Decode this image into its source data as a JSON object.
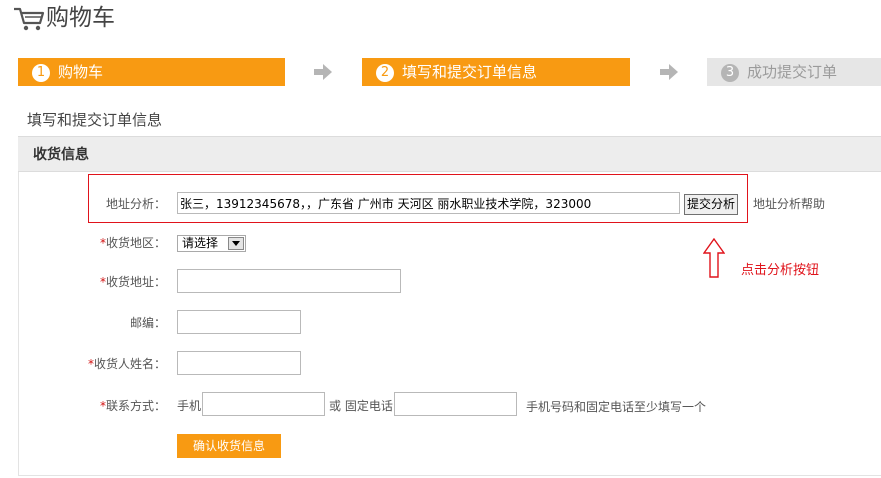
{
  "header": {
    "title": "购物车",
    "icon": "shopping-cart-icon"
  },
  "steps": [
    {
      "num": "1",
      "label": "购物车",
      "state": "active"
    },
    {
      "num": "2",
      "label": "填写和提交订单信息",
      "state": "active"
    },
    {
      "num": "3",
      "label": "成功提交订单",
      "state": "inactive"
    }
  ],
  "section_title": "填写和提交订单信息",
  "panel": {
    "title": "收货信息"
  },
  "form": {
    "address_parse": {
      "label": "地址分析：",
      "value": "张三，13912345678，，广东省 广州市 天河区 丽水职业技术学院，323000",
      "button": "提交分析",
      "help": "地址分析帮助"
    },
    "region": {
      "required_mark": "*",
      "label": "收货地区：",
      "selected": "请选择"
    },
    "address": {
      "required_mark": "*",
      "label": "收货地址：",
      "value": ""
    },
    "postcode": {
      "label": "邮编：",
      "value": ""
    },
    "name": {
      "required_mark": "*",
      "label": "收货人姓名：",
      "value": ""
    },
    "contact": {
      "required_mark": "*",
      "label": "联系方式：",
      "mobile_label": "手机",
      "mobile_value": "",
      "or_label": "或 固定电话",
      "phone_value": "",
      "hint": "手机号码和固定电话至少填写一个"
    },
    "confirm_button": "确认收货信息"
  },
  "annotation": {
    "text": "点击分析按钮"
  },
  "colors": {
    "accent": "#f89a12",
    "annotation": "#e0131b",
    "inactive_step": "#e6e6e6"
  }
}
